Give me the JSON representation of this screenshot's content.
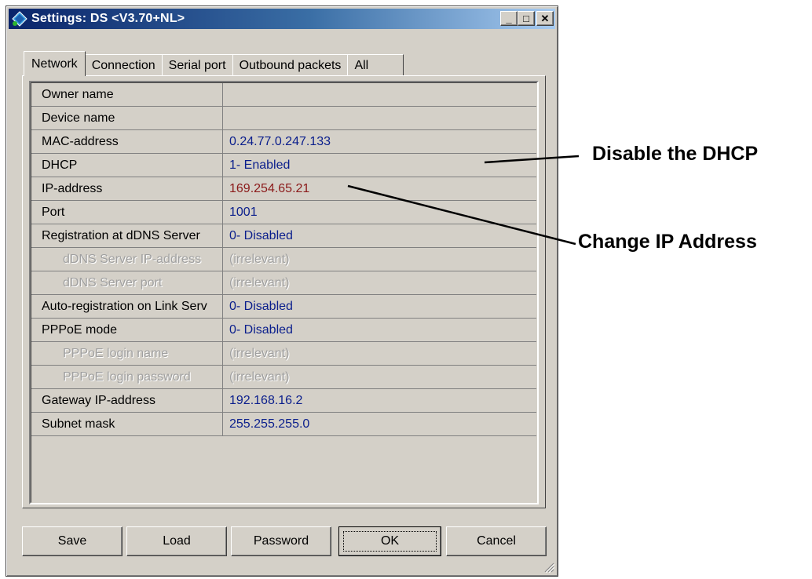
{
  "window": {
    "title": "Settings: DS <V3.70+NL>",
    "buttons": {
      "minimize": "_",
      "maximize": "□",
      "close": "✕"
    }
  },
  "tabs": [
    "Network",
    "Connection",
    "Serial port",
    "Outbound packets",
    "All"
  ],
  "active_tab": "Network",
  "rows": [
    {
      "name": "Owner name",
      "value": ""
    },
    {
      "name": "Device name",
      "value": ""
    },
    {
      "name": "MAC-address",
      "value": "0.24.77.0.247.133"
    },
    {
      "name": "DHCP",
      "value": "1- Enabled"
    },
    {
      "name": "IP-address",
      "value": "169.254.65.21"
    },
    {
      "name": "Port",
      "value": "1001"
    },
    {
      "name": "Registration at dDNS Server",
      "value": "0- Disabled"
    },
    {
      "name": "dDNS Server IP-address",
      "value": "(irrelevant)"
    },
    {
      "name": "dDNS Server port",
      "value": "(irrelevant)"
    },
    {
      "name": "Auto-registration on Link Serv",
      "value": "0- Disabled"
    },
    {
      "name": "PPPoE mode",
      "value": "0- Disabled"
    },
    {
      "name": "PPPoE login name",
      "value": "(irrelevant)"
    },
    {
      "name": "PPPoE login password",
      "value": "(irrelevant)"
    },
    {
      "name": "Gateway IP-address",
      "value": "192.168.16.2"
    },
    {
      "name": "Subnet mask",
      "value": "255.255.255.0"
    }
  ],
  "buttons": {
    "save": "Save",
    "load": "Load",
    "password": "Password",
    "ok": "OK",
    "cancel": "Cancel"
  },
  "annotations": {
    "dhcp": "Disable the DHCP",
    "ip": "Change IP Address"
  },
  "colors": {
    "value_text": "#0a1e8c",
    "ip_value_text": "#8b1a1a",
    "disabled_text": "#a0a0a0",
    "title_bar_start": "#0a246a",
    "title_bar_end": "#a6caf0"
  }
}
